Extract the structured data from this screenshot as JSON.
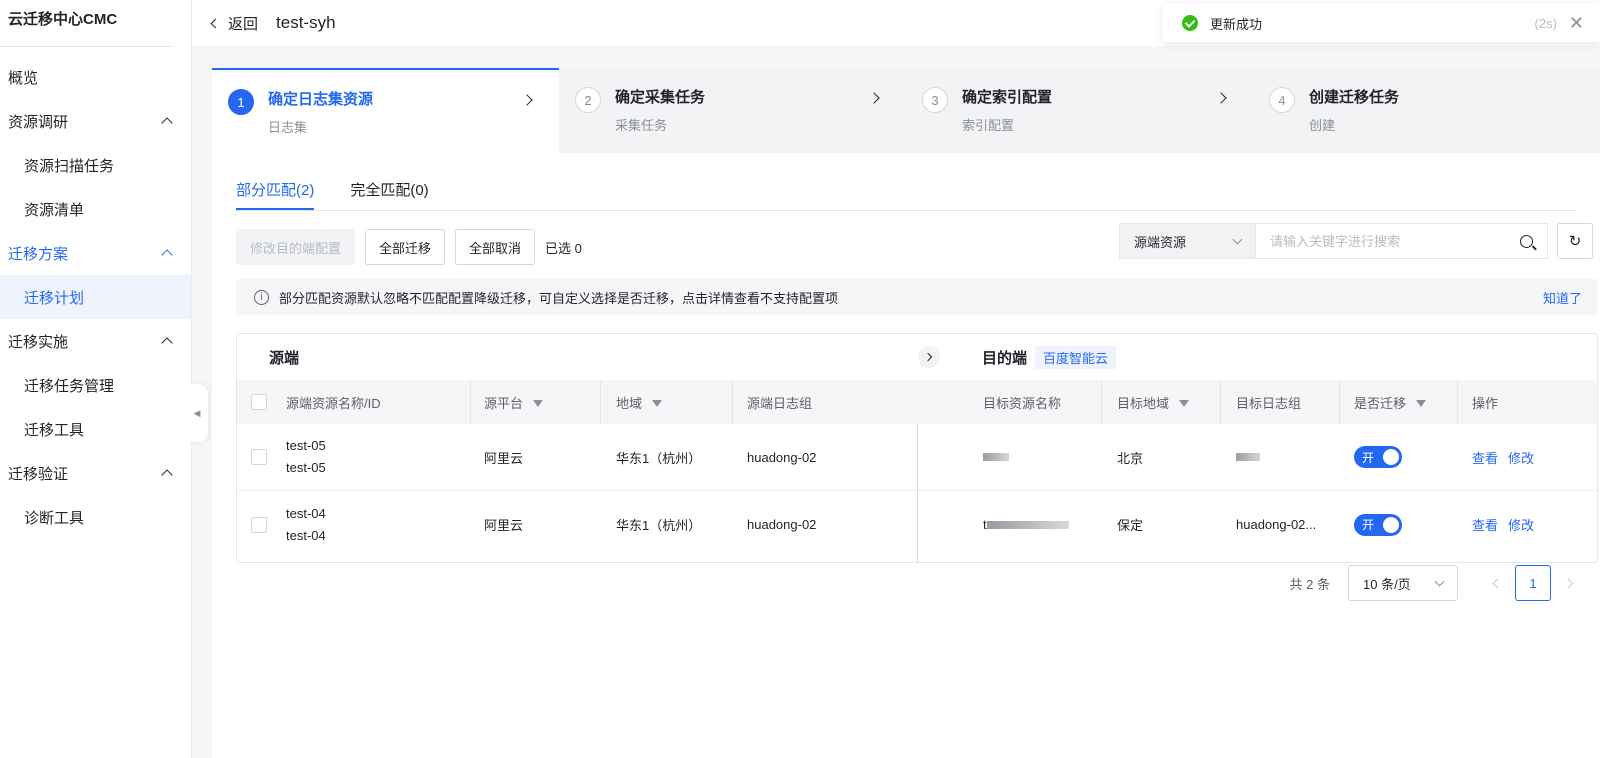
{
  "app": {
    "brand": "云迁移中心CMC"
  },
  "sidebar": {
    "overview": "概览",
    "groups": [
      {
        "label": "资源调研",
        "items": [
          "资源扫描任务",
          "资源清单"
        ]
      },
      {
        "label": "迁移方案",
        "items": [
          "迁移计划"
        ]
      },
      {
        "label": "迁移实施",
        "items": [
          "迁移任务管理",
          "迁移工具"
        ]
      },
      {
        "label": "迁移验证",
        "items": [
          "诊断工具"
        ]
      }
    ]
  },
  "header": {
    "back_label": "返回",
    "title": "test-syh"
  },
  "toast": {
    "message": "更新成功",
    "timer": "(2s)",
    "close": "✕"
  },
  "steps": [
    {
      "num": "1",
      "title": "确定日志集资源",
      "sub": "日志集"
    },
    {
      "num": "2",
      "title": "确定采集任务",
      "sub": "采集任务"
    },
    {
      "num": "3",
      "title": "确定索引配置",
      "sub": "索引配置"
    },
    {
      "num": "4",
      "title": "创建迁移任务",
      "sub": "创建"
    }
  ],
  "tabs": [
    "部分匹配(2)",
    "完全匹配(0)"
  ],
  "toolbar": {
    "modify_dest": "修改目的端配置",
    "migrate_all": "全部迁移",
    "cancel_all": "全部取消",
    "selected": "已选 0"
  },
  "search": {
    "scope": "源端资源",
    "placeholder": "请输入关键字进行搜索"
  },
  "info": {
    "text": "部分匹配资源默认忽略不匹配配置降级迁移，可自定义选择是否迁移，点击详情查看不支持配置项",
    "link": "知道了"
  },
  "table": {
    "source_group": "源端",
    "dest_group": "目的端",
    "dest_badge": "百度智能云",
    "columns": {
      "name": "源端资源名称/ID",
      "platform": "源平台",
      "region": "地域",
      "log_group": "源端日志组",
      "target_name": "目标资源名称",
      "target_region": "目标地域",
      "target_log_group": "目标日志组",
      "migrate": "是否迁移",
      "action": "操作"
    },
    "rows": [
      {
        "name": "test-05",
        "id": "test-05",
        "platform": "阿里云",
        "region": "华东1（杭州）",
        "log_group": "huadong-02",
        "target_name": "",
        "target_region": "北京",
        "target_log_group": "",
        "migrate": "开",
        "view": "查看",
        "edit": "修改"
      },
      {
        "name": "test-04",
        "id": "test-04",
        "platform": "阿里云",
        "region": "华东1（杭州）",
        "log_group": "huadong-02",
        "target_name": "t",
        "target_region": "保定",
        "target_log_group": "huadong-02...",
        "migrate": "开",
        "view": "查看",
        "edit": "修改"
      }
    ]
  },
  "pager": {
    "total": "共 2 条",
    "page_size": "10 条/页",
    "current": "1"
  },
  "colors": {
    "accent": "#2468f2",
    "success": "#30bf13"
  }
}
